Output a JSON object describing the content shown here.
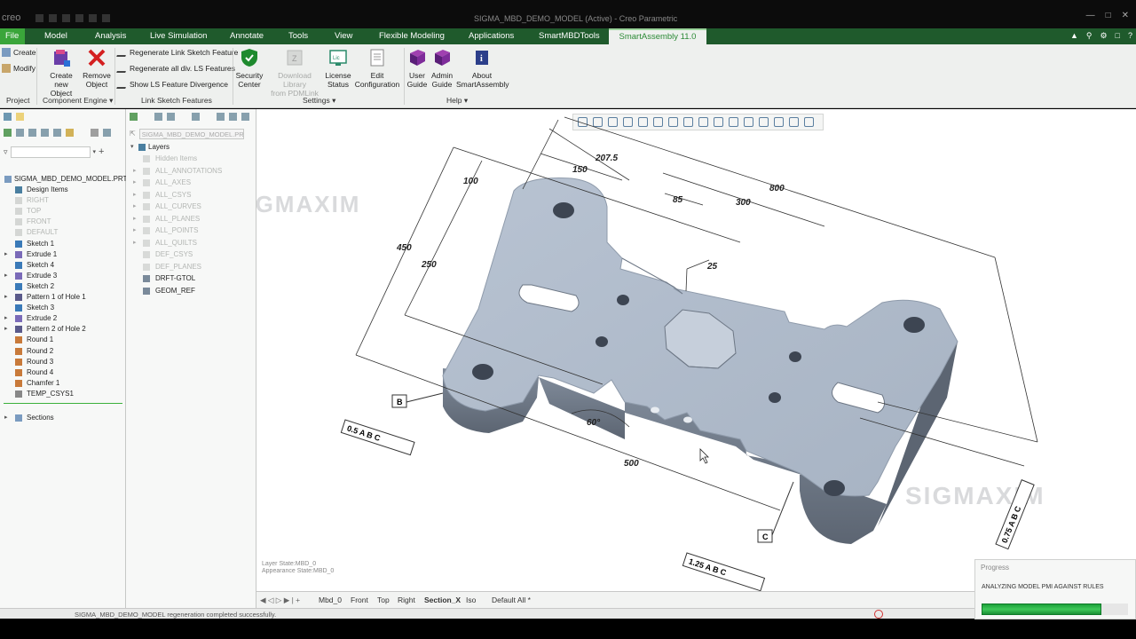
{
  "titlebar": {
    "logo": "creo",
    "window_title": "SIGMA_MBD_DEMO_MODEL (Active) - Creo Parametric"
  },
  "tabs": [
    "File",
    "Model",
    "Analysis",
    "Live Simulation",
    "Annotate",
    "Tools",
    "View",
    "Flexible Modeling",
    "Applications",
    "SmartMBDTools",
    "SmartAssembly 11.0"
  ],
  "ribbon": {
    "project": {
      "create": "Create",
      "modify": "Modify",
      "group": "Project"
    },
    "component_engine": {
      "create_new_line1": "Create new",
      "create_new_line2": "Object",
      "remove_line1": "Remove",
      "remove_line2": "Object",
      "group": "Component Engine"
    },
    "link_sketch": {
      "regen_feature": "Regenerate Link Sketch Feature",
      "regen_all": "Regenerate all div. LS Features",
      "show_div": "Show LS Feature Divergence",
      "group": "Link Sketch Features"
    },
    "settings": {
      "security_l1": "Security",
      "security_l2": "Center",
      "download_l1": "Download Library",
      "download_l2": "from PDMLink",
      "license_l1": "License",
      "license_l2": "Status",
      "edit_l1": "Edit",
      "edit_l2": "Configuration",
      "group": "Settings"
    },
    "help": {
      "user_l1": "User",
      "user_l2": "Guide",
      "admin_l1": "Admin",
      "admin_l2": "Guide",
      "about_l1": "About",
      "about_l2": "SmartAssembly",
      "group": "Help"
    }
  },
  "model_tree": {
    "root": "SIGMA_MBD_DEMO_MODEL.PRT",
    "items": [
      "Design Items",
      "RIGHT",
      "TOP",
      "FRONT",
      "DEFAULT",
      "Sketch 1",
      "Extrude 1",
      "Sketch 4",
      "Extrude 3",
      "Sketch 2",
      "Pattern 1 of Hole 1",
      "Sketch 3",
      "Extrude 2",
      "Pattern 2 of Hole 2",
      "Round 1",
      "Round 2",
      "Round 3",
      "Round 4",
      "Chamfer 1",
      "TEMP_CSYS1"
    ],
    "sections": "Sections"
  },
  "layers": {
    "model_select": "SIGMA_MBD_DEMO_MODEL.PR",
    "title": "Layers",
    "items": [
      "Hidden Items",
      "ALL_ANNOTATIONS",
      "ALL_AXES",
      "ALL_CSYS",
      "ALL_CURVES",
      "ALL_PLANES",
      "ALL_POINTS",
      "ALL_QUILTS",
      "DEF_CSYS",
      "DEF_PLANES",
      "DRFT-GTOL",
      "GEOM_REF"
    ]
  },
  "viewport": {
    "watermark": "SIGMAXIM",
    "layer_state": "Layer State:MBD_0",
    "appearance_state": "Appearance State:MBD_0",
    "dims": {
      "d800": "800",
      "d300": "300",
      "d207": "207.5",
      "d150": "150",
      "d85": "85",
      "d25": "25",
      "d100": "100",
      "d450": "450",
      "d250": "250",
      "d500": "500",
      "d60": "60°"
    },
    "gtol": {
      "left": "0.5 A B C",
      "right": "0.75 A B C",
      "bottom": "1.25 A B C",
      "datum_b": "B",
      "datum_c": "C"
    }
  },
  "view_tabs": [
    "Mbd_0",
    "Front",
    "Top",
    "Right",
    "Section_X",
    "Iso",
    "Default All *"
  ],
  "status": {
    "message": "SIGMA_MBD_DEMO_MODEL regeneration completed successfully."
  },
  "progress": {
    "title": "Progress",
    "message": "ANALYZING MODEL PMI AGAINST RULES",
    "value": 0.82
  }
}
